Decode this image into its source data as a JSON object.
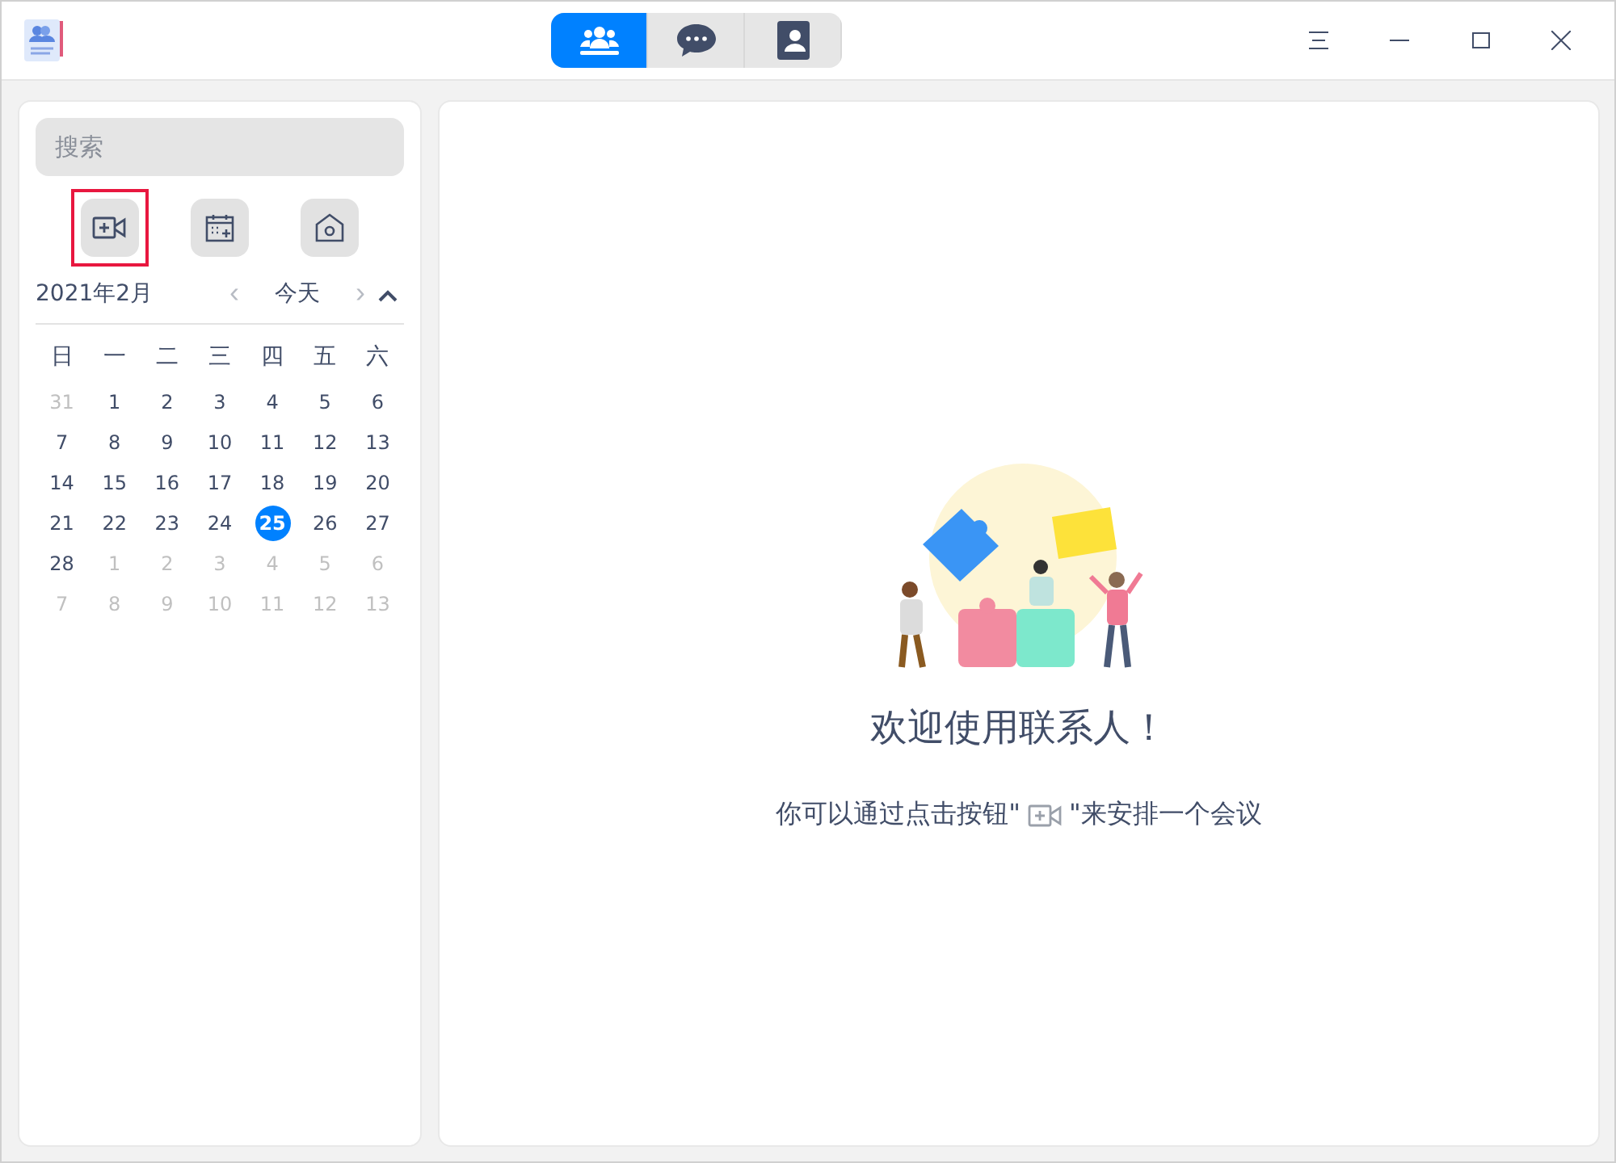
{
  "view_tabs": [
    {
      "kind": "meeting",
      "selected": true
    },
    {
      "kind": "chat",
      "selected": false
    },
    {
      "kind": "contacts",
      "selected": false
    }
  ],
  "search": {
    "placeholder": "搜索"
  },
  "tools": [
    {
      "kind": "video",
      "highlighted": true
    },
    {
      "kind": "calendar",
      "highlighted": false
    },
    {
      "kind": "home",
      "highlighted": false
    }
  ],
  "calendar": {
    "month": "2021年2月",
    "prev": "‹",
    "today": "今天",
    "next": "›",
    "weekdays": [
      "日",
      "一",
      "二",
      "三",
      "四",
      "五",
      "六"
    ],
    "weeks": [
      [
        {
          "d": "31",
          "muted": true,
          "selected": false
        },
        {
          "d": "1",
          "muted": false,
          "selected": false
        },
        {
          "d": "2",
          "muted": false,
          "selected": false
        },
        {
          "d": "3",
          "muted": false,
          "selected": false
        },
        {
          "d": "4",
          "muted": false,
          "selected": false
        },
        {
          "d": "5",
          "muted": false,
          "selected": false
        },
        {
          "d": "6",
          "muted": false,
          "selected": false
        }
      ],
      [
        {
          "d": "7",
          "muted": false,
          "selected": false
        },
        {
          "d": "8",
          "muted": false,
          "selected": false
        },
        {
          "d": "9",
          "muted": false,
          "selected": false
        },
        {
          "d": "10",
          "muted": false,
          "selected": false
        },
        {
          "d": "11",
          "muted": false,
          "selected": false
        },
        {
          "d": "12",
          "muted": false,
          "selected": false
        },
        {
          "d": "13",
          "muted": false,
          "selected": false
        }
      ],
      [
        {
          "d": "14",
          "muted": false,
          "selected": false
        },
        {
          "d": "15",
          "muted": false,
          "selected": false
        },
        {
          "d": "16",
          "muted": false,
          "selected": false
        },
        {
          "d": "17",
          "muted": false,
          "selected": false
        },
        {
          "d": "18",
          "muted": false,
          "selected": false
        },
        {
          "d": "19",
          "muted": false,
          "selected": false
        },
        {
          "d": "20",
          "muted": false,
          "selected": false
        }
      ],
      [
        {
          "d": "21",
          "muted": false,
          "selected": false
        },
        {
          "d": "22",
          "muted": false,
          "selected": false
        },
        {
          "d": "23",
          "muted": false,
          "selected": false
        },
        {
          "d": "24",
          "muted": false,
          "selected": false
        },
        {
          "d": "25",
          "muted": false,
          "selected": true
        },
        {
          "d": "26",
          "muted": false,
          "selected": false
        },
        {
          "d": "27",
          "muted": false,
          "selected": false
        }
      ],
      [
        {
          "d": "28",
          "muted": false,
          "selected": false
        },
        {
          "d": "1",
          "muted": true,
          "selected": false
        },
        {
          "d": "2",
          "muted": true,
          "selected": false
        },
        {
          "d": "3",
          "muted": true,
          "selected": false
        },
        {
          "d": "4",
          "muted": true,
          "selected": false
        },
        {
          "d": "5",
          "muted": true,
          "selected": false
        },
        {
          "d": "6",
          "muted": true,
          "selected": false
        }
      ],
      [
        {
          "d": "7",
          "muted": true,
          "selected": false
        },
        {
          "d": "8",
          "muted": true,
          "selected": false
        },
        {
          "d": "9",
          "muted": true,
          "selected": false
        },
        {
          "d": "10",
          "muted": true,
          "selected": false
        },
        {
          "d": "11",
          "muted": true,
          "selected": false
        },
        {
          "d": "12",
          "muted": true,
          "selected": false
        },
        {
          "d": "13",
          "muted": true,
          "selected": false
        }
      ]
    ]
  },
  "welcome": {
    "title": "欢迎使用联系人！",
    "hint_before": "你可以通过点击按钮\"",
    "hint_after": "\"来安排一个会议"
  }
}
